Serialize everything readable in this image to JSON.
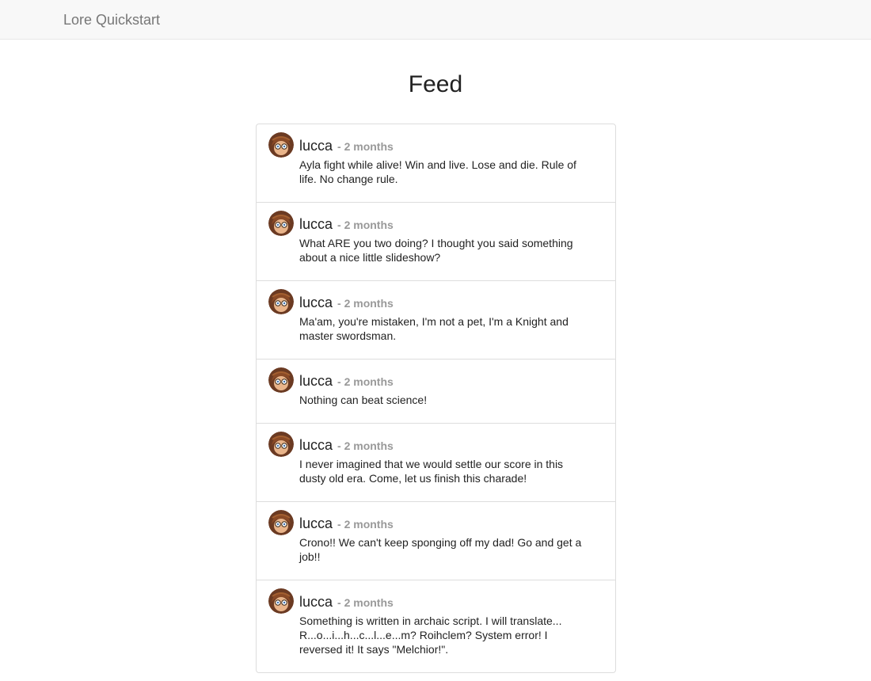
{
  "navbar": {
    "brand": "Lore Quickstart"
  },
  "page": {
    "title": "Feed"
  },
  "avatar_icon": "avatar-lucca-icon",
  "tweets": [
    {
      "author": "lucca",
      "time": "- 2 months",
      "text": "Ayla fight while alive! Win and live. Lose and die. Rule of life. No change rule."
    },
    {
      "author": "lucca",
      "time": "- 2 months",
      "text": "What ARE you two doing? I thought you said something about a nice little slideshow?"
    },
    {
      "author": "lucca",
      "time": "- 2 months",
      "text": "Ma'am, you're mistaken, I'm not a pet, I'm a Knight and master swordsman."
    },
    {
      "author": "lucca",
      "time": "- 2 months",
      "text": "Nothing can beat science!"
    },
    {
      "author": "lucca",
      "time": "- 2 months",
      "text": "I never imagined that we would settle our score in this dusty old era. Come, let us finish this charade!"
    },
    {
      "author": "lucca",
      "time": "- 2 months",
      "text": "Crono!! We can't keep sponging off my dad! Go and get a job!!"
    },
    {
      "author": "lucca",
      "time": "- 2 months",
      "text": "Something is written in archaic script. I will translate... R...o...i...h...c...l...e...m? Roihclem? System error! I reversed it! It says \"Melchior!\"."
    }
  ]
}
